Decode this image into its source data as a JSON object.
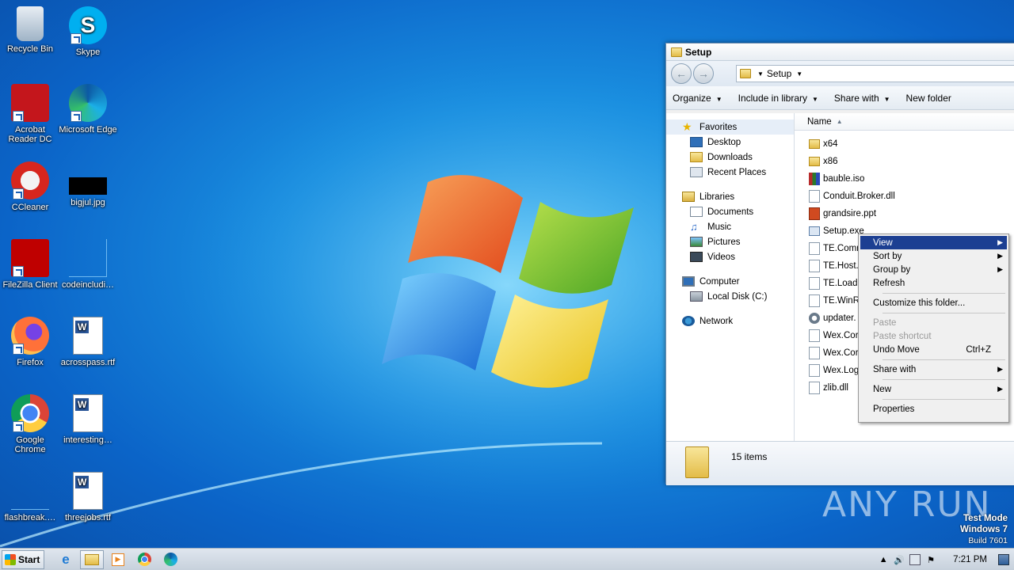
{
  "desktop": {
    "icons": [
      {
        "label": "Recycle Bin"
      },
      {
        "label": "Skype"
      },
      {
        "label": "Acrobat Reader DC"
      },
      {
        "label": "Microsoft Edge"
      },
      {
        "label": "CCleaner"
      },
      {
        "label": "bigjul.jpg"
      },
      {
        "label": "FileZilla Client"
      },
      {
        "label": "codeincludi…"
      },
      {
        "label": "Firefox"
      },
      {
        "label": "acrosspass.rtf"
      },
      {
        "label": "Google Chrome"
      },
      {
        "label": "interesting…"
      },
      {
        "label": "flashbreak.…"
      },
      {
        "label": "threejobs.rtf"
      }
    ]
  },
  "explorer": {
    "title": "Setup",
    "address": "Setup",
    "toolbar": {
      "organize": "Organize",
      "include": "Include in library",
      "share": "Share with",
      "new_folder": "New folder"
    },
    "nav": {
      "favorites": "Favorites",
      "desktop": "Desktop",
      "downloads": "Downloads",
      "recent": "Recent Places",
      "libraries": "Libraries",
      "documents": "Documents",
      "music": "Music",
      "pictures": "Pictures",
      "videos": "Videos",
      "computer": "Computer",
      "localdisk": "Local Disk (C:)",
      "network": "Network"
    },
    "column_name": "Name",
    "files": [
      "x64",
      "x86",
      "bauble.iso",
      "Conduit.Broker.dll",
      "grandsire.ppt",
      "Setup.exe",
      "TE.Comn",
      "TE.Host.",
      "TE.Loade",
      "TE.WinR",
      "updater.",
      "Wex.Cor",
      "Wex.Cor",
      "Wex.Log",
      "zlib.dll"
    ],
    "status": "15 items"
  },
  "context_menu": {
    "view": "View",
    "sort_by": "Sort by",
    "group_by": "Group by",
    "refresh": "Refresh",
    "customize": "Customize this folder...",
    "paste": "Paste",
    "paste_shortcut": "Paste shortcut",
    "undo_move": "Undo Move",
    "undo_shortcut": "Ctrl+Z",
    "share_with": "Share with",
    "new": "New",
    "properties": "Properties"
  },
  "taskbar": {
    "start": "Start",
    "clock": "7:21 PM"
  },
  "watermark": {
    "line1": "Test Mode",
    "line2": "Windows 7",
    "line3": "Build 7601",
    "brand": "ANY RUN"
  },
  "colors": {
    "menu_highlight": "#1c3f92",
    "desktop_blue": "#1a8fe0"
  }
}
